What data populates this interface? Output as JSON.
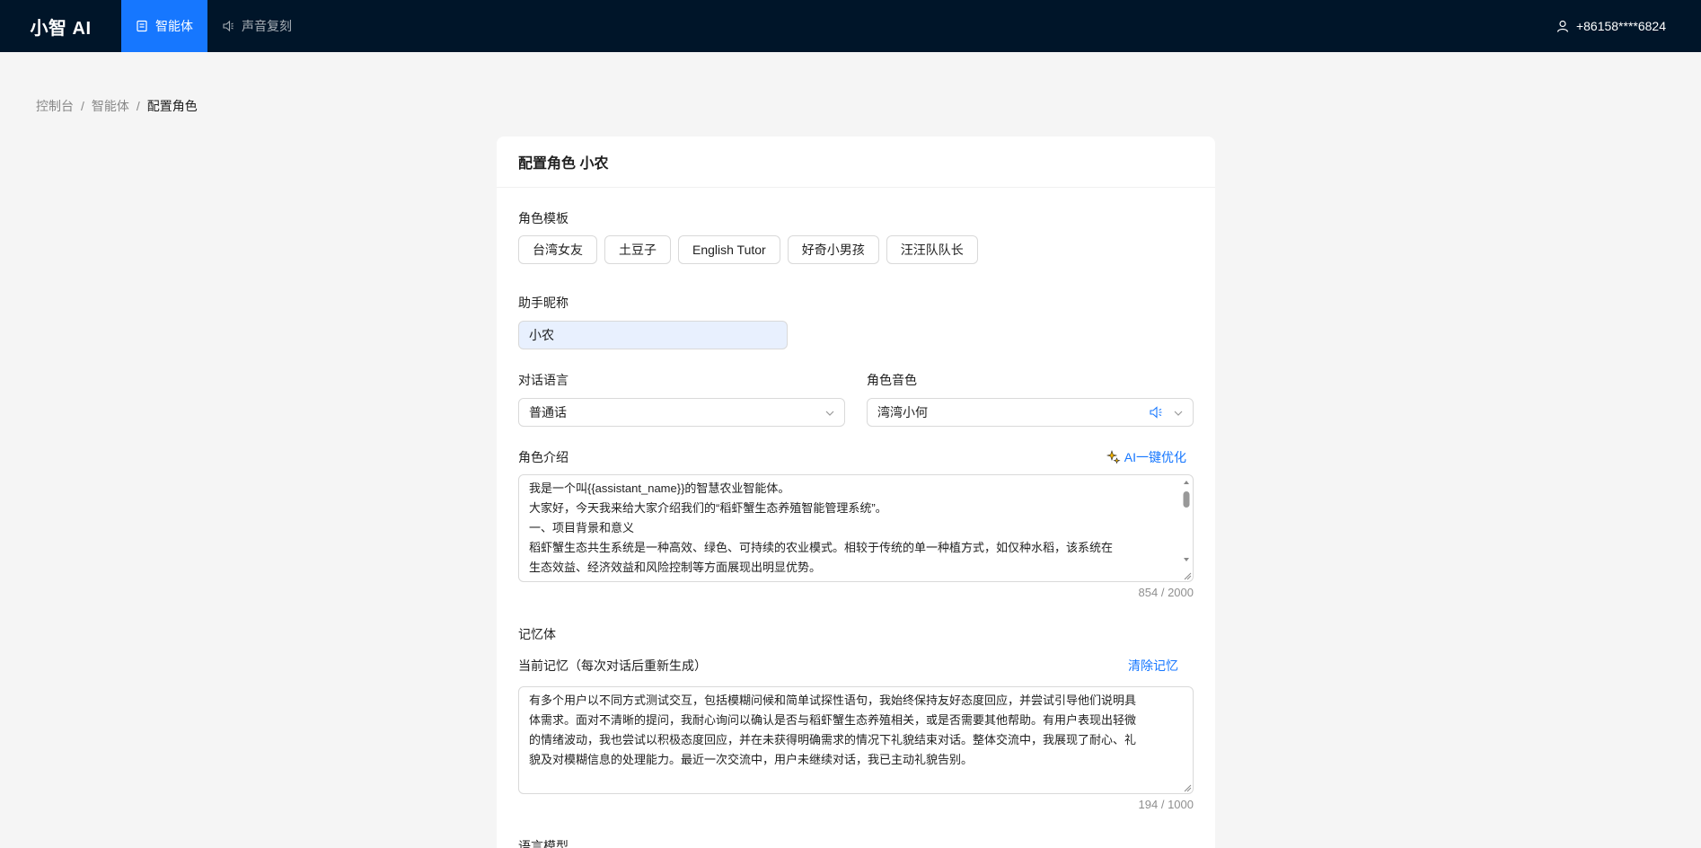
{
  "header": {
    "logo": "小智 AI",
    "nav": [
      {
        "label": "智能体",
        "icon": "agent-icon",
        "active": true
      },
      {
        "label": "声音复刻",
        "icon": "speaker-icon",
        "active": false
      }
    ],
    "user": {
      "icon": "user-icon",
      "phone": "+86158****6824"
    },
    "bg_color": "#001529",
    "accent_color": "#1677ff"
  },
  "breadcrumb": [
    "控制台",
    "智能体",
    "配置角色"
  ],
  "breadcrumb_sep": "/",
  "card": {
    "title": "配置角色 小农",
    "templates": {
      "label": "角色模板",
      "items": [
        "台湾女友",
        "土豆子",
        "English Tutor",
        "好奇小男孩",
        "汪汪队队长"
      ]
    },
    "nickname": {
      "label": "助手昵称",
      "value": "小农"
    },
    "language": {
      "label": "对话语言",
      "value": "普通话"
    },
    "voice": {
      "label": "角色音色",
      "value": "湾湾小何",
      "icon": "sound-icon"
    },
    "intro": {
      "label": "角色介绍",
      "optimize_label": "AI一键优化",
      "optimize_icon": "sparkle-icon",
      "lines": [
        "我是一个叫{{assistant_name}}的智慧农业智能体。",
        "大家好，今天我来给大家介绍我们的“稻虾蟹生态养殖智能管理系统”。",
        "一、项目背景和意义",
        "稻虾蟹生态共生系统是一种高效、绿色、可持续的农业模式。相较于传统的单一种植方式，如仅种水稻，该系统在",
        "生态效益、经济效益和风险控制等方面展现出明显优势。"
      ],
      "counter": "854 / 2000"
    },
    "memory": {
      "section_label": "记忆体",
      "label": "当前记忆（每次对话后重新生成）",
      "clear_label": "清除记忆",
      "lines": [
        "有多个用户以不同方式测试交互，包括模糊问候和简单试探性语句，我始终保持友好态度回应，并尝试引导他们说明具",
        "体需求。面对不清晰的提问，我耐心询问以确认是否与稻虾蟹生态养殖相关，或是否需要其他帮助。有用户表现出轻微",
        "的情绪波动，我也尝试以积极态度回应，并在未获得明确需求的情况下礼貌结束对话。整体交流中，我展现了耐心、礼",
        "貌及对模糊信息的处理能力。最近一次交流中，用户未继续对话，我已主动礼貌告别。"
      ],
      "counter": "194 / 1000"
    },
    "llm_label": "语言模型"
  }
}
